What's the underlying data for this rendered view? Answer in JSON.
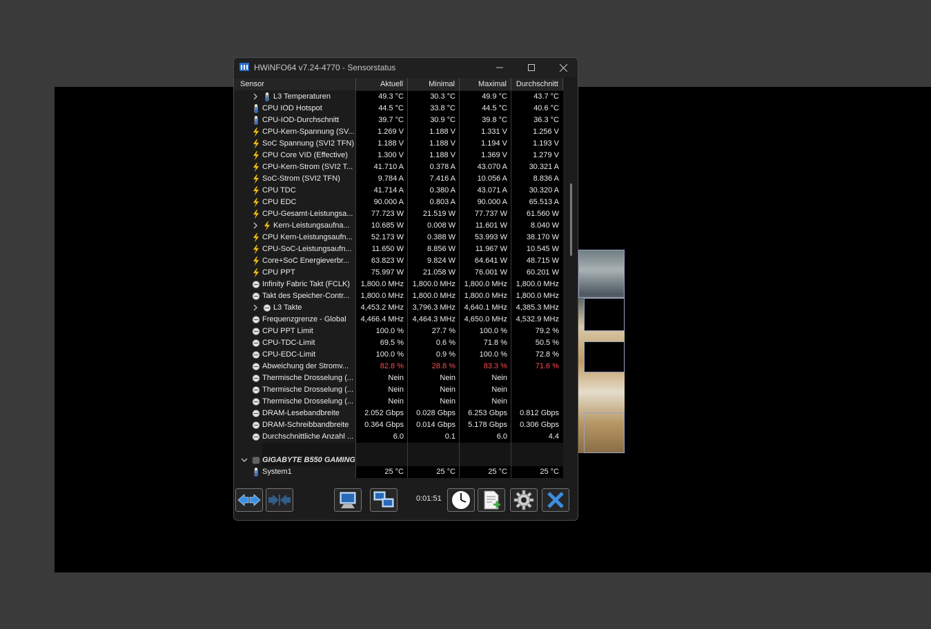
{
  "window": {
    "title": "HWiNFO64 v7.24-4770 - Sensorstatus",
    "minimize_glyph": "—",
    "maximize_glyph": "☐",
    "close_glyph": "✕"
  },
  "columns": {
    "sensor": "Sensor",
    "current": "Aktuell",
    "min": "Minimal",
    "max": "Maximal",
    "avg": "Durchschnitt"
  },
  "rows": [
    {
      "icon": "thermometer-icon",
      "expandable": true,
      "sub": true,
      "label": "L3 Temperaturen",
      "cur": "49.3 °C",
      "min": "30.3 °C",
      "max": "49.9 °C",
      "avg": "43.7 °C"
    },
    {
      "icon": "thermometer-icon",
      "label": "CPU IOD Hotspot",
      "cur": "44.5 °C",
      "min": "33.8 °C",
      "max": "44.5 °C",
      "avg": "40.6 °C"
    },
    {
      "icon": "thermometer-icon",
      "label": "CPU-IOD-Durchschnitt",
      "cur": "39.7 °C",
      "min": "30.9 °C",
      "max": "39.8 °C",
      "avg": "36.3 °C"
    },
    {
      "icon": "lightning-icon",
      "label": "CPU-Kern-Spannung (SV...",
      "cur": "1.269 V",
      "min": "1.188 V",
      "max": "1.331 V",
      "avg": "1.256 V"
    },
    {
      "icon": "lightning-icon",
      "label": "SoC Spannung (SVI2 TFN)",
      "cur": "1.188 V",
      "min": "1.188 V",
      "max": "1.194 V",
      "avg": "1.193 V"
    },
    {
      "icon": "lightning-icon",
      "label": "CPU Core VID (Effective)",
      "cur": "1.300 V",
      "min": "1.188 V",
      "max": "1.369 V",
      "avg": "1.279 V"
    },
    {
      "icon": "lightning-icon",
      "label": "CPU-Kern-Strom (SVI2 T...",
      "cur": "41.710 A",
      "min": "0.378 A",
      "max": "43.070 A",
      "avg": "30.321 A"
    },
    {
      "icon": "lightning-icon",
      "label": "SoC-Strom (SVI2 TFN)",
      "cur": "9.784 A",
      "min": "7.416 A",
      "max": "10.056 A",
      "avg": "8.836 A"
    },
    {
      "icon": "lightning-icon",
      "label": "CPU TDC",
      "cur": "41.714 A",
      "min": "0.380 A",
      "max": "43.071 A",
      "avg": "30.320 A"
    },
    {
      "icon": "lightning-icon",
      "label": "CPU EDC",
      "cur": "90.000 A",
      "min": "0.803 A",
      "max": "90.000 A",
      "avg": "65.513 A"
    },
    {
      "icon": "lightning-icon",
      "label": "CPU-Gesamt-Leistungsa...",
      "cur": "77.723 W",
      "min": "21.519 W",
      "max": "77.737 W",
      "avg": "61.560 W"
    },
    {
      "icon": "lightning-icon",
      "expandable": true,
      "sub": true,
      "label": "Kern-Leistungsaufna...",
      "cur": "10.685 W",
      "min": "0.008 W",
      "max": "11.601 W",
      "avg": "8.040 W"
    },
    {
      "icon": "lightning-icon",
      "label": "CPU Kern-Leistungsaufn...",
      "cur": "52.173 W",
      "min": "0.388 W",
      "max": "53.993 W",
      "avg": "38.170 W"
    },
    {
      "icon": "lightning-icon",
      "label": "CPU-SoC-Leistungsaufn...",
      "cur": "11.650 W",
      "min": "8.856 W",
      "max": "11.967 W",
      "avg": "10.545 W"
    },
    {
      "icon": "lightning-icon",
      "label": "Core+SoC Energieverbr...",
      "cur": "63.823 W",
      "min": "9.824 W",
      "max": "64.641 W",
      "avg": "48.715 W"
    },
    {
      "icon": "lightning-icon",
      "label": "CPU PPT",
      "cur": "75.997 W",
      "min": "21.058 W",
      "max": "76.001 W",
      "avg": "60.201 W"
    },
    {
      "icon": "gauge-icon",
      "label": "Infinity Fabric Takt (FCLK)",
      "cur": "1,800.0 MHz",
      "min": "1,800.0 MHz",
      "max": "1,800.0 MHz",
      "avg": "1,800.0 MHz"
    },
    {
      "icon": "gauge-icon",
      "label": "Takt des Speicher-Contr...",
      "cur": "1,800.0 MHz",
      "min": "1,800.0 MHz",
      "max": "1,800.0 MHz",
      "avg": "1,800.0 MHz"
    },
    {
      "icon": "gauge-icon",
      "expandable": true,
      "sub": true,
      "label": "L3 Takte",
      "cur": "4,453.2 MHz",
      "min": "3,796.3 MHz",
      "max": "4,640.1 MHz",
      "avg": "4,385.3 MHz"
    },
    {
      "icon": "gauge-icon",
      "label": "Frequenzgrenze - Global",
      "cur": "4,466.4 MHz",
      "min": "4,464.3 MHz",
      "max": "4,650.0 MHz",
      "avg": "4,532.9 MHz"
    },
    {
      "icon": "gauge-icon",
      "label": "CPU PPT Limit",
      "cur": "100.0 %",
      "min": "27.7 %",
      "max": "100.0 %",
      "avg": "79.2 %"
    },
    {
      "icon": "gauge-icon",
      "label": "CPU-TDC-Limit",
      "cur": "69.5 %",
      "min": "0.6 %",
      "max": "71.8 %",
      "avg": "50.5 %"
    },
    {
      "icon": "gauge-icon",
      "label": "CPU-EDC-Limit",
      "cur": "100.0 %",
      "min": "0.9 %",
      "max": "100.0 %",
      "avg": "72.8 %"
    },
    {
      "icon": "gauge-icon",
      "red": true,
      "label": "Abweichung der Stromv...",
      "cur": "82.8 %",
      "min": "28.8 %",
      "max": "83.3 %",
      "avg": "71.6 %"
    },
    {
      "icon": "gauge-icon",
      "label": "Thermische Drosselung (...",
      "cur": "Nein",
      "min": "Nein",
      "max": "Nein",
      "avg": ""
    },
    {
      "icon": "gauge-icon",
      "label": "Thermische Drosselung (...",
      "cur": "Nein",
      "min": "Nein",
      "max": "Nein",
      "avg": ""
    },
    {
      "icon": "gauge-icon",
      "label": "Thermische Drosselung (...",
      "cur": "Nein",
      "min": "Nein",
      "max": "Nein",
      "avg": ""
    },
    {
      "icon": "gauge-icon",
      "label": "DRAM-Lesebandbreite",
      "cur": "2.052 Gbps",
      "min": "0.028 Gbps",
      "max": "6.253 Gbps",
      "avg": "0.812 Gbps"
    },
    {
      "icon": "gauge-icon",
      "label": "DRAM-Schreibbandbreite",
      "cur": "0.364 Gbps",
      "min": "0.014 Gbps",
      "max": "5.178 Gbps",
      "avg": "0.306 Gbps"
    },
    {
      "icon": "gauge-icon",
      "label": "Durchschnittliche Anzahl ...",
      "cur": "6.0",
      "min": "0.1",
      "max": "6.0",
      "avg": "4.4"
    },
    {
      "separator": true
    },
    {
      "group": true,
      "icon": "chip-icon",
      "label": "GIGABYTE B550 GAMING..."
    },
    {
      "icon": "thermometer-icon",
      "label": "System1",
      "cur": "25 °C",
      "min": "25 °C",
      "max": "25 °C",
      "avg": "25 °C"
    }
  ],
  "toolbar": {
    "timer": "0:01:51",
    "buttons": [
      "expand-arrows-icon",
      "collapse-arrows-icon",
      "monitor-icon",
      "network-icon",
      "clock-icon",
      "report-add-icon",
      "gear-icon",
      "close-x-icon"
    ]
  },
  "colors": {
    "accent_blue": "#3a8fe0",
    "alert_red": "#ff4d4d",
    "bolt_yellow": "#f5c518"
  }
}
